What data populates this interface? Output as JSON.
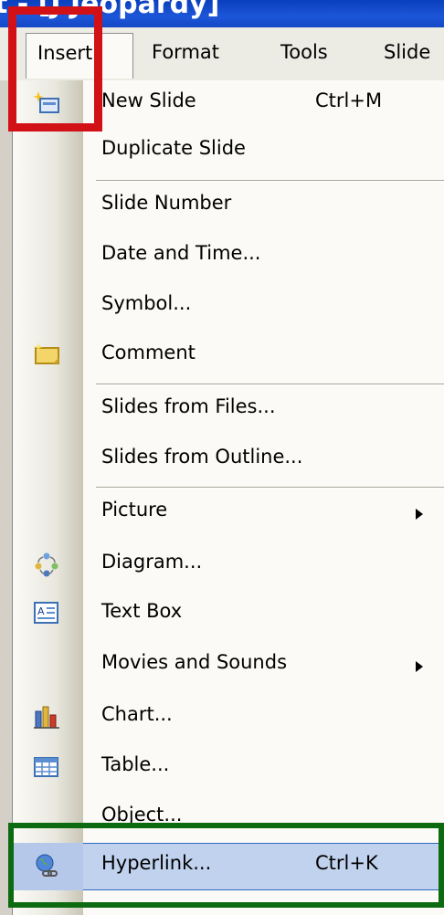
{
  "window": {
    "title_fragment": "t - [J Jeopardy]"
  },
  "menubar": {
    "insert": "Insert",
    "format": "Format",
    "tools": "Tools",
    "slide": "Slide"
  },
  "menu": {
    "items": [
      {
        "label": "New Slide",
        "accel": "Ctrl+M",
        "icon": "new-slide-icon"
      },
      {
        "label": "Duplicate Slide"
      },
      {
        "label": "Slide Number"
      },
      {
        "label": "Date and Time..."
      },
      {
        "label": "Symbol..."
      },
      {
        "label": "Comment",
        "icon": "comment-icon"
      },
      {
        "label": "Slides from Files..."
      },
      {
        "label": "Slides from Outline..."
      },
      {
        "label": "Picture",
        "submenu": true
      },
      {
        "label": "Diagram...",
        "icon": "diagram-icon"
      },
      {
        "label": "Text Box",
        "icon": "text-box-icon"
      },
      {
        "label": "Movies and Sounds",
        "submenu": true
      },
      {
        "label": "Chart...",
        "icon": "chart-icon"
      },
      {
        "label": "Table...",
        "icon": "table-icon"
      },
      {
        "label": "Object..."
      },
      {
        "label": "Hyperlink...",
        "accel": "Ctrl+K",
        "icon": "hyperlink-icon",
        "highlighted": true
      }
    ]
  },
  "colors": {
    "highlight_box_red": "#d21117",
    "highlight_box_green": "#0c6a10",
    "menu_highlight": "#c1d2ee"
  }
}
